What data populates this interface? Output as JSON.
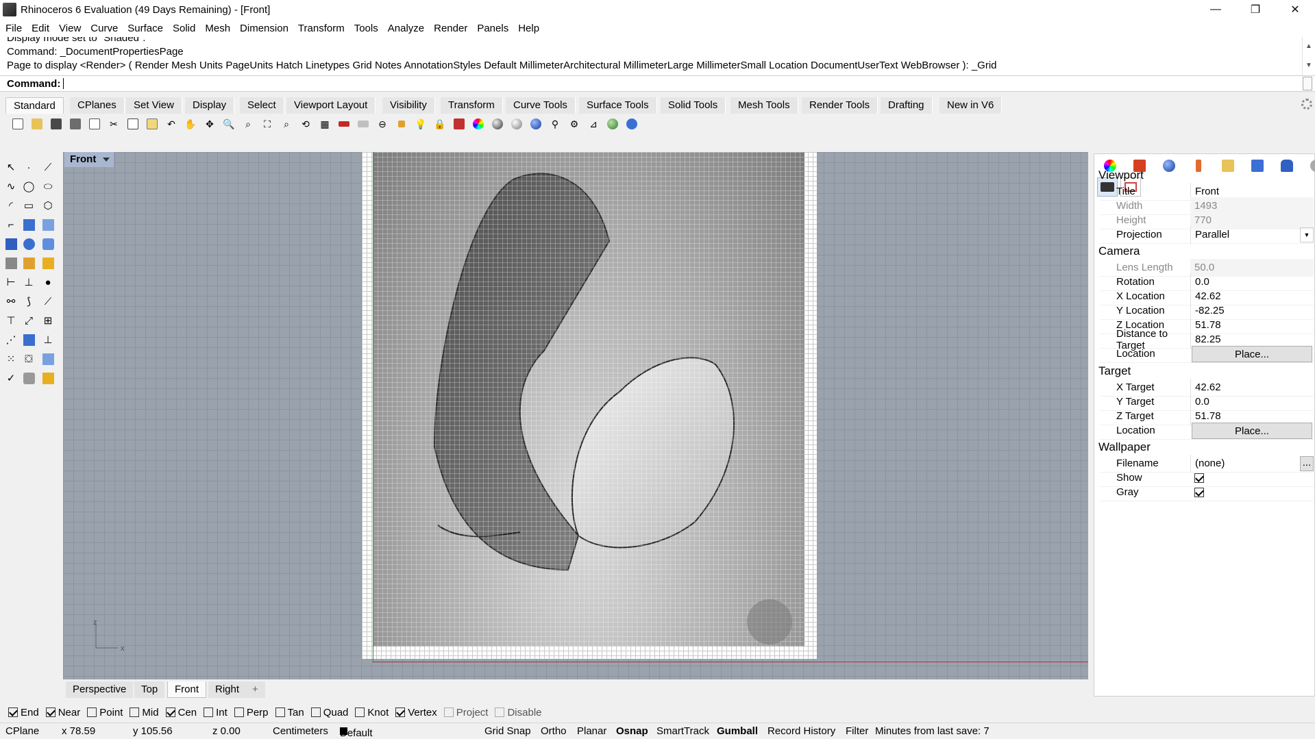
{
  "window": {
    "title": "Rhinoceros 6 Evaluation (49 Days Remaining) - [Front]",
    "buttons": [
      "—",
      "❐",
      "✕"
    ]
  },
  "menu": [
    "File",
    "Edit",
    "View",
    "Curve",
    "Surface",
    "Solid",
    "Mesh",
    "Dimension",
    "Transform",
    "Tools",
    "Analyze",
    "Render",
    "Panels",
    "Help"
  ],
  "command_history": [
    "Display mode set to \"Shaded\".",
    "Command: _DocumentPropertiesPage",
    "Page to display <Render> ( Render  Mesh  Units  PageUnits  Hatch  Linetypes  Grid  Notes  AnnotationStyles  Default  MillimeterArchitectural  MillimeterLarge  MillimeterSmall  Location  DocumentUserText  WebBrowser ): _Grid"
  ],
  "command_prompt": "Command:",
  "toolbar_tabs": [
    "Standard",
    "CPlanes",
    "Set View",
    "Display",
    "Select",
    "Viewport Layout",
    "Visibility",
    "Transform",
    "Curve Tools",
    "Surface Tools",
    "Solid Tools",
    "Mesh Tools",
    "Render Tools",
    "Drafting",
    "New in V6"
  ],
  "active_toolbar_tab": "Standard",
  "viewport": {
    "label": "Front",
    "axis_labels": {
      "z": "z",
      "x": "x"
    }
  },
  "viewport_tabs": [
    "Perspective",
    "Top",
    "Front",
    "Right",
    "+"
  ],
  "active_viewport_tab": "Front",
  "panel": {
    "viewport_section": "Viewport",
    "camera_section": "Camera",
    "target_section": "Target",
    "wallpaper_section": "Wallpaper",
    "viewport_rows": [
      {
        "key": "Title",
        "value": "Front"
      },
      {
        "key": "Width",
        "value": "1493"
      },
      {
        "key": "Height",
        "value": "770"
      },
      {
        "key": "Projection",
        "value": "Parallel"
      }
    ],
    "camera_rows": [
      {
        "key": "Lens Length",
        "value": "50.0"
      },
      {
        "key": "Rotation",
        "value": "0.0"
      },
      {
        "key": "X Location",
        "value": "42.62"
      },
      {
        "key": "Y Location",
        "value": "-82.25"
      },
      {
        "key": "Z Location",
        "value": "51.78"
      },
      {
        "key": "Distance to Target",
        "value": "82.25"
      },
      {
        "key": "Location",
        "value": "Place..."
      }
    ],
    "target_rows": [
      {
        "key": "X Target",
        "value": "42.62"
      },
      {
        "key": "Y Target",
        "value": "0.0"
      },
      {
        "key": "Z Target",
        "value": "51.78"
      },
      {
        "key": "Location",
        "value": "Place..."
      }
    ],
    "wallpaper_rows": [
      {
        "key": "Filename",
        "value": "(none)",
        "button": "..."
      },
      {
        "key": "Show",
        "checked": true
      },
      {
        "key": "Gray",
        "checked": true
      }
    ]
  },
  "osnaps": [
    {
      "label": "End",
      "checked": true
    },
    {
      "label": "Near",
      "checked": true
    },
    {
      "label": "Point",
      "checked": false
    },
    {
      "label": "Mid",
      "checked": false
    },
    {
      "label": "Cen",
      "checked": true
    },
    {
      "label": "Int",
      "checked": false
    },
    {
      "label": "Perp",
      "checked": false
    },
    {
      "label": "Tan",
      "checked": false
    },
    {
      "label": "Quad",
      "checked": false
    },
    {
      "label": "Knot",
      "checked": false
    },
    {
      "label": "Vertex",
      "checked": true
    },
    {
      "label": "Project",
      "checked": false,
      "dim": true
    },
    {
      "label": "Disable",
      "checked": false,
      "dim": true
    }
  ],
  "status": {
    "cplane": "CPlane",
    "x": "x 78.59",
    "y": "y 105.56",
    "z": "z 0.00",
    "units": "Centimeters",
    "layer": "Default",
    "grid_snap": "Grid Snap",
    "ortho": "Ortho",
    "planar": "Planar",
    "osnap": "Osnap",
    "smarttrack": "SmartTrack",
    "gumball": "Gumball",
    "record_history": "Record History",
    "filter": "Filter",
    "save_info": "Minutes from last save: 7"
  }
}
